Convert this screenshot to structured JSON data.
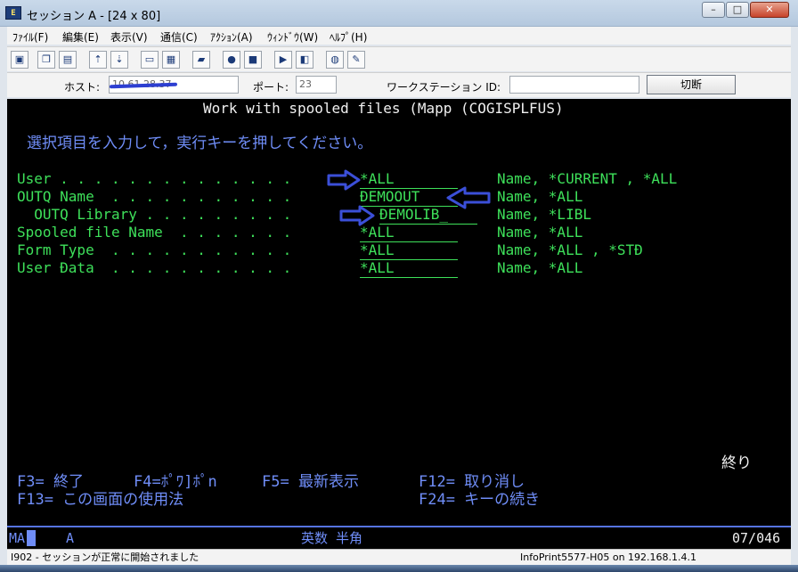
{
  "window": {
    "title": "セッション A - [24 x 80]",
    "app_icon_text": "E",
    "controls": {
      "minimize": "–",
      "maximize": "□",
      "close": "✕"
    }
  },
  "menu": [
    "ﾌｧｲﾙ(F)",
    "編集(E)",
    "表示(V)",
    "通信(C)",
    "ｱｸｼｮﾝ(A)",
    "ｳｨﾝﾄﾞｳ(W)",
    "ﾍﾙﾌﾟ(H)"
  ],
  "toolbar": {
    "icons": [
      "print-screen-icon",
      "copy-icon",
      "paste-icon",
      "send-file-icon",
      "receive-file-icon",
      "display-icon",
      "keypad-icon",
      "macro-record-icon",
      "macro-stop-icon",
      "macro-play-icon",
      "play-icon",
      "macro-icon",
      "web-globe-icon",
      "help-icon"
    ]
  },
  "hostbar": {
    "host_label": "ホスト:",
    "host_value": "10.61.28.37",
    "port_label": "ポート:",
    "port_value": "23",
    "workstation_label": "ワークステーション ID:",
    "workstation_value": "",
    "disconnect_button": "切断"
  },
  "terminal": {
    "title": "Work with spooled files (Mapp (COGISPLFUS)",
    "instruction": "選択項目を入力して，実行キーを押してください。",
    "fields": [
      {
        "label": "User . . . . . . . . . . . . . .",
        "value": "*ALL",
        "hint": "Name, *CURRENT , *ALL"
      },
      {
        "label": "OUTQ Name  . . . . . . . . . . .",
        "value": "ĐEMOOUT",
        "hint": "Name, *ALL"
      },
      {
        "label": "  OUTQ Library . . . . . . . . .",
        "value": "ĐEMOLIB_",
        "hint": "Name, *LIBL"
      },
      {
        "label": "Spooled file Name  . . . . . . .",
        "value": "*ALL",
        "hint": "Name, *ALL"
      },
      {
        "label": "Form Type  . . . . . . . . . . .",
        "value": "*ALL",
        "hint": "Name, *ALL , *STĐ"
      },
      {
        "label": "User Đata  . . . . . . . . . . .",
        "value": "*ALL",
        "hint": "Name, *ALL"
      }
    ],
    "end_label": "終り",
    "fkeys_row1": [
      "F3= 終了",
      "F4=ﾎﾟﾜ]ﾎﾟn",
      "F5= 最新表示",
      "F12= 取り消し"
    ],
    "fkeys_row2": [
      "F13= この画面の使用法",
      "F24= キーの続き"
    ]
  },
  "oia": {
    "left_a": "MA",
    "left_b": "A",
    "input_mode": "英数 半角",
    "cursor_pos": "07/046"
  },
  "status": {
    "message": "I902 - セッションが正常に開始されました",
    "info": "InfoPrint5577-H05 on 192.168.1.4.1"
  },
  "colors": {
    "terminal_bg": "#000000",
    "field_green": "#3ee05a",
    "instruction_blue": "#6f8df7",
    "arrow_blue": "#3b4fd8"
  }
}
